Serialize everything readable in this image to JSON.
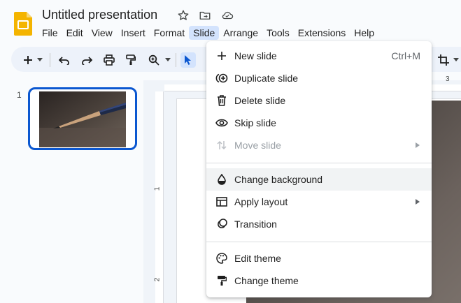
{
  "header": {
    "title": "Untitled presentation",
    "menu": [
      "File",
      "Edit",
      "View",
      "Insert",
      "Format",
      "Slide",
      "Arrange",
      "Tools",
      "Extensions",
      "Help"
    ],
    "active_menu": "Slide"
  },
  "toolbar": {
    "icons": [
      "add-icon",
      "dropdown-arrow-icon",
      "undo-icon",
      "redo-icon",
      "print-icon",
      "paint-format-icon",
      "zoom-icon",
      "dropdown-arrow-icon",
      "select-icon",
      "crop-icon"
    ]
  },
  "filmstrip": {
    "slide_number": "1"
  },
  "ruler": {
    "top_mark": "3",
    "left_marks": [
      "1",
      "2"
    ]
  },
  "slide_menu": {
    "items": [
      {
        "label": "New slide",
        "shortcut": "Ctrl+M",
        "icon": "plus-icon"
      },
      {
        "label": "Duplicate slide",
        "icon": "duplicate-icon"
      },
      {
        "label": "Delete slide",
        "icon": "trash-icon"
      },
      {
        "label": "Skip slide",
        "icon": "eye-icon"
      },
      {
        "label": "Move slide",
        "icon": "move-icon",
        "disabled": true,
        "submenu": true
      },
      {
        "label": "Change background",
        "icon": "fill-drop-icon",
        "highlighted": true
      },
      {
        "label": "Apply layout",
        "icon": "layout-icon",
        "submenu": true
      },
      {
        "label": "Transition",
        "icon": "transition-icon"
      },
      {
        "label": "Edit theme",
        "icon": "palette-icon"
      },
      {
        "label": "Change theme",
        "icon": "paint-roller-icon"
      }
    ]
  },
  "colors": {
    "accent": "#0b57d0",
    "active_menu_bg": "#d3e3fd",
    "logo": "#f4b400"
  }
}
